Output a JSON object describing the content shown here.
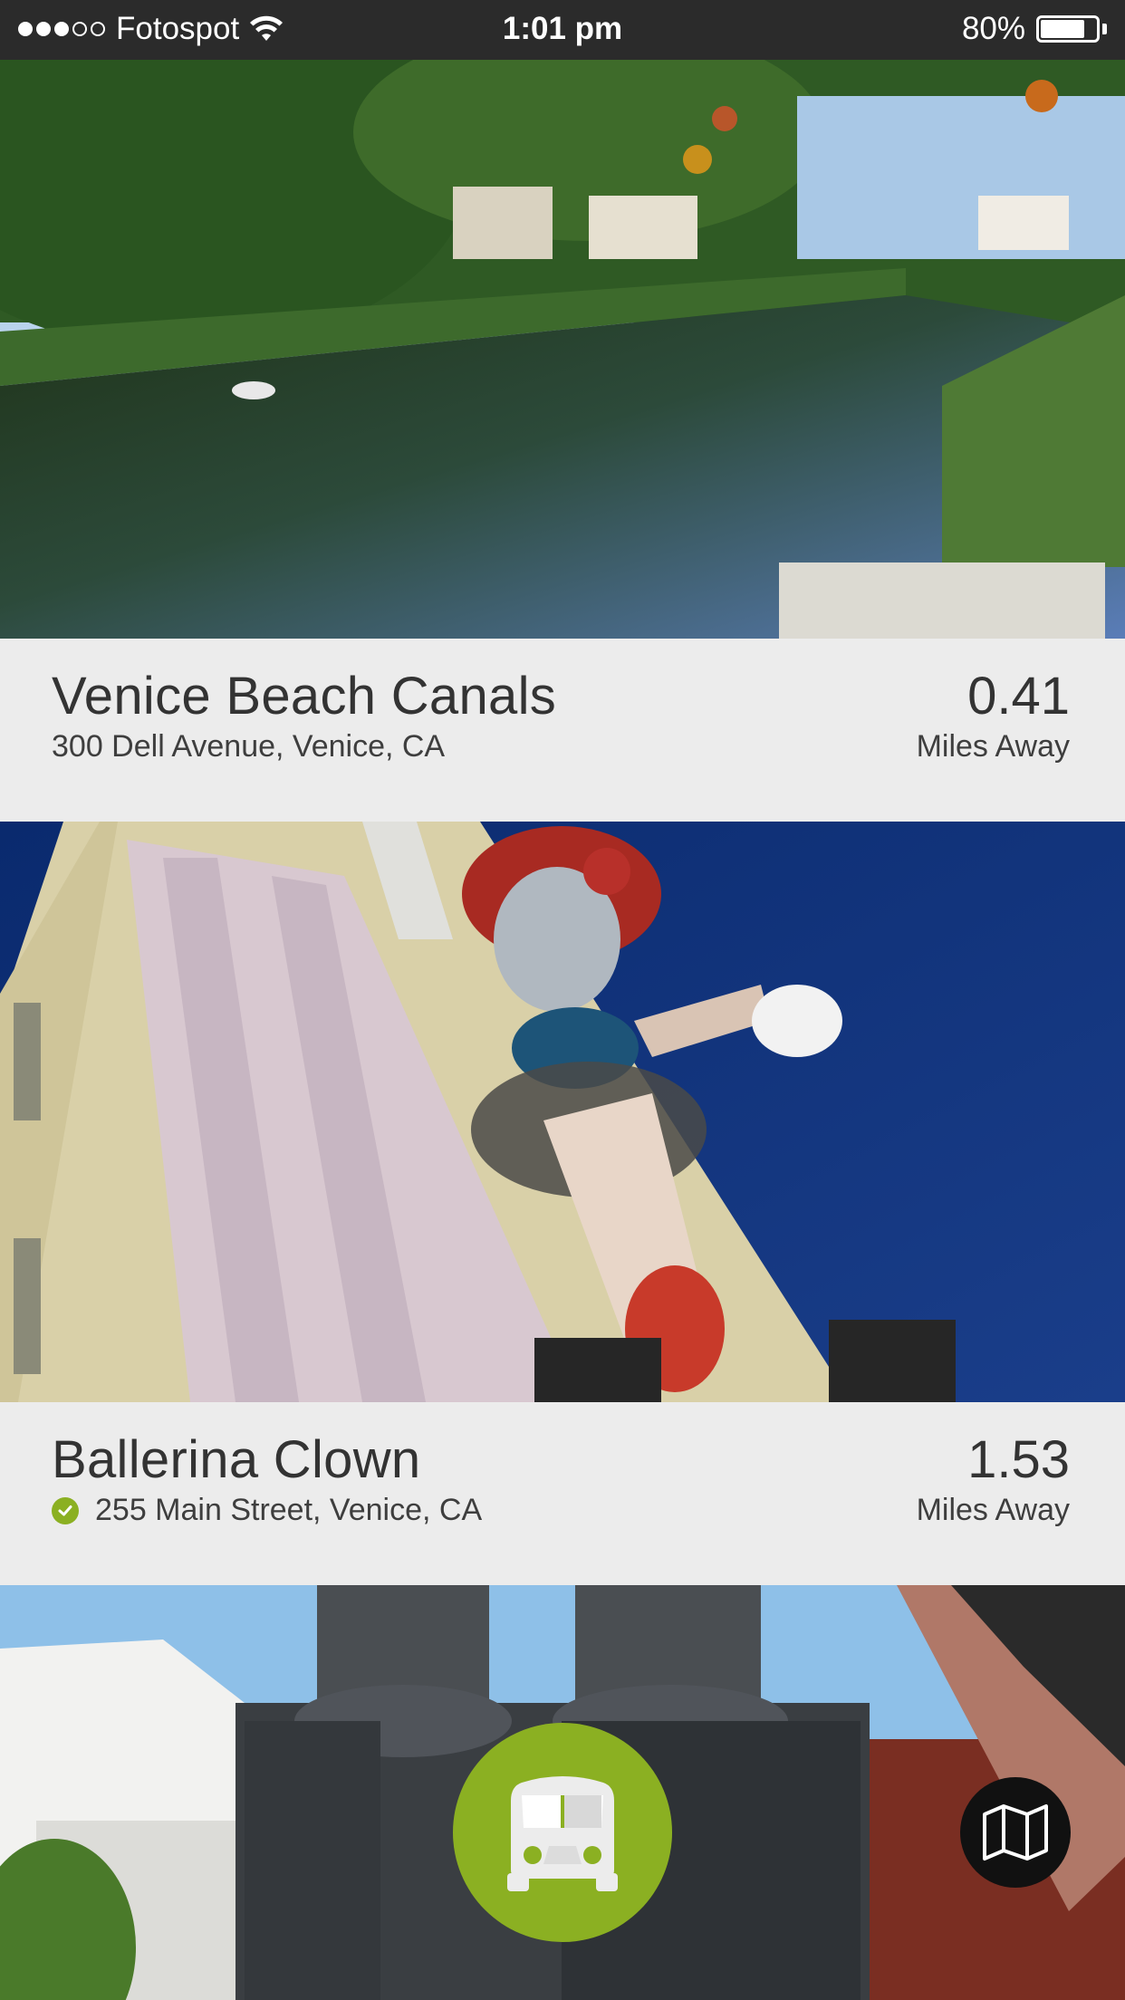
{
  "status_bar": {
    "carrier": "Fotospot",
    "signal_bars": 3,
    "signal_total": 5,
    "time": "1:01 pm",
    "battery_percent": "80%",
    "battery_level": 0.8
  },
  "places": [
    {
      "name": "Venice Beach Canals",
      "address": "300 Dell Avenue, Venice, CA",
      "distance": "0.41",
      "distance_unit": "Miles Away",
      "visited": false
    },
    {
      "name": "Ballerina Clown",
      "address": "255 Main Street, Venice, CA",
      "distance": "1.53",
      "distance_unit": "Miles Away",
      "visited": true
    }
  ],
  "buttons": {
    "tours": {
      "icon": "van-icon"
    },
    "map": {
      "icon": "map-icon"
    }
  },
  "colors": {
    "accent_green": "#8bb022",
    "status_bar": "#2b2b2b",
    "card_background": "#ececec",
    "text_dark": "#333333"
  }
}
